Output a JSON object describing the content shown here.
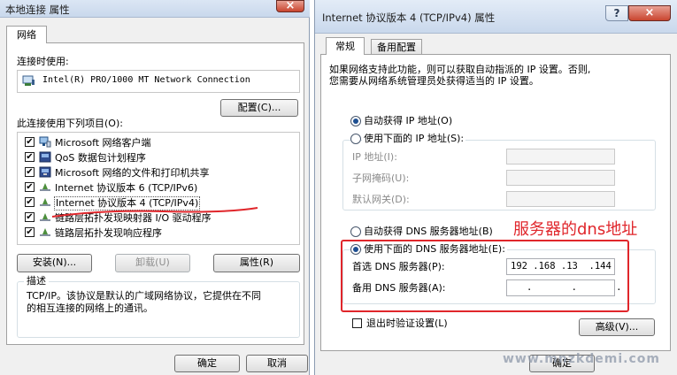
{
  "left": {
    "title": "本地连接 属性",
    "tab": "网络",
    "connect_using_label": "连接时使用:",
    "adapter_name": "Intel(R) PRO/1000 MT Network Connection",
    "configure_button": "配置(C)...",
    "items_label": "此连接使用下列项目(O):",
    "items": [
      {
        "checked": true,
        "icon": "network-client-icon",
        "label": "Microsoft 网络客户端"
      },
      {
        "checked": true,
        "icon": "qos-scheduler-icon",
        "label": "QoS 数据包计划程序"
      },
      {
        "checked": true,
        "icon": "file-sharing-icon",
        "label": "Microsoft 网络的文件和打印机共享"
      },
      {
        "checked": true,
        "icon": "protocol-icon",
        "label": "Internet 协议版本 6 (TCP/IPv6)"
      },
      {
        "checked": true,
        "icon": "protocol-icon",
        "label": "Internet 协议版本 4 (TCP/IPv4)"
      },
      {
        "checked": true,
        "icon": "protocol-icon",
        "label": "链路层拓扑发现映射器 I/O 驱动程序"
      },
      {
        "checked": true,
        "icon": "protocol-icon",
        "label": "链路层拓扑发现响应程序"
      }
    ],
    "install_button": "安装(N)...",
    "uninstall_button": "卸载(U)",
    "properties_button": "属性(R)",
    "description_label": "描述",
    "description_text_1": "TCP/IP。该协议是默认的广域网络协议，它提供在不同",
    "description_text_2": "的相互连接的网络上的通讯。",
    "ok_button": "确定",
    "cancel_button": "取消"
  },
  "right": {
    "title": "Internet 协议版本 4 (TCP/IPv4) 属性",
    "help_icon": "?",
    "tab_general": "常规",
    "tab_alternate": "备用配置",
    "intro_line_1": "如果网络支持此功能，则可以获取自动指派的 IP 设置。否则,",
    "intro_line_2": "您需要从网络系统管理员处获得适当的 IP 设置。",
    "auto_ip_label": "自动获得 IP 地址(O)",
    "manual_ip_label": "使用下面的 IP 地址(S):",
    "ip_address_label": "IP 地址(I):",
    "subnet_label": "子网掩码(U):",
    "gateway_label": "默认网关(D):",
    "auto_dns_label": "自动获得 DNS 服务器地址(B)",
    "manual_dns_label": "使用下面的 DNS 服务器地址(E):",
    "preferred_dns_label": "首选 DNS 服务器(P):",
    "preferred_dns_value": "192 .168 .13  .144",
    "alternate_dns_label": "备用 DNS 服务器(A):",
    "alternate_dns_value": ".       .       .",
    "validate_label": "退出时验证设置(L)",
    "advanced_button": "高级(V)...",
    "ok_button": "确定",
    "annotation_text": "服务器的dns地址",
    "watermark": "www.mnzkdemi.com"
  },
  "colors": {
    "annotation_red": "#e0262b",
    "selection_blue": "#3399ff",
    "title_bar": "#c9d8ec"
  }
}
